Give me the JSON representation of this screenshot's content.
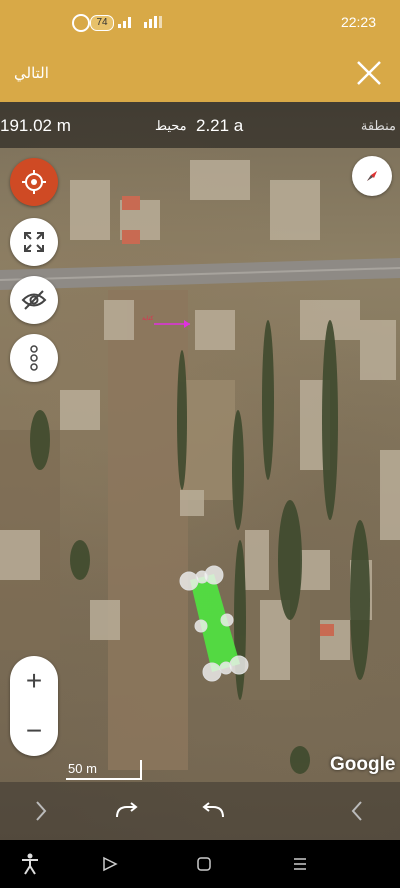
{
  "status_bar": {
    "time": "22:23",
    "battery": "74",
    "icons": [
      "whatsapp-icon",
      "battery-icon",
      "signal-icon",
      "wifi-icon"
    ]
  },
  "header": {
    "next_label": "التالي",
    "close_icon": "close-icon",
    "background_color": "#d8a947"
  },
  "measure_bar": {
    "area_value": "191.02 m",
    "perimeter_label": "محيط",
    "perimeter_value": "2.21 a",
    "area_label": "منطقة"
  },
  "controls": {
    "locate_icon": "crosshair-icon",
    "expand_icon": "expand-icon",
    "hide_icon": "eye-off-icon",
    "more_icon": "more-vertical-icon",
    "compass_icon": "compass-icon",
    "zoom_in": "+",
    "zoom_out": "−",
    "locate_color": "#cf4a24"
  },
  "map": {
    "scale_label": "50 m",
    "logo": "Google",
    "road_text": "ﻛﺘﺎﺑﺔ",
    "polygon_color": "#4fe640"
  },
  "action_bar": {
    "icons": [
      "chevron-right-icon",
      "redo-icon",
      "undo-icon",
      "chevron-left-icon"
    ]
  },
  "nav_bar": {
    "icons": [
      "accessibility-icon",
      "back-triangle-icon",
      "home-square-icon",
      "recents-lines-icon"
    ]
  }
}
